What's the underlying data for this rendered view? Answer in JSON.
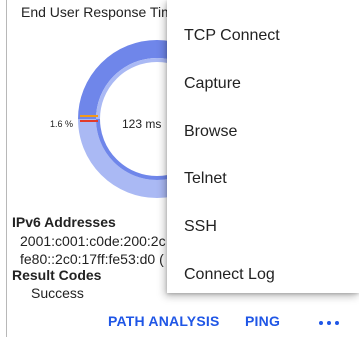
{
  "card": {
    "title": "End User Response Tim",
    "gauge": {
      "left_label": "1.6 %",
      "center_label": "123 ms",
      "fill_fraction": 0.5,
      "colors": {
        "outer": "#6f86ea",
        "inner": "#aab9f4",
        "marker_orange": "#f39a1b",
        "marker_red": "#e23b2a"
      }
    },
    "ipv6": {
      "heading": "IPv6 Addresses",
      "addresses": [
        "2001:c001:c0de:200:2c",
        "fe80::2c0:17ff:fe53:d0 ("
      ]
    },
    "result_codes": {
      "heading": "Result Codes",
      "value": "Success"
    }
  },
  "bottom_bar": {
    "path_analysis": "PATH ANALYSIS",
    "ping": "PING",
    "more_icon": "more-horizontal-icon",
    "accent": "#1f56e6"
  },
  "menu": {
    "items": [
      {
        "label": "TCP Connect"
      },
      {
        "label": "Capture"
      },
      {
        "label": "Browse"
      },
      {
        "label": "Telnet"
      },
      {
        "label": "SSH"
      },
      {
        "label": "Connect Log"
      }
    ]
  }
}
